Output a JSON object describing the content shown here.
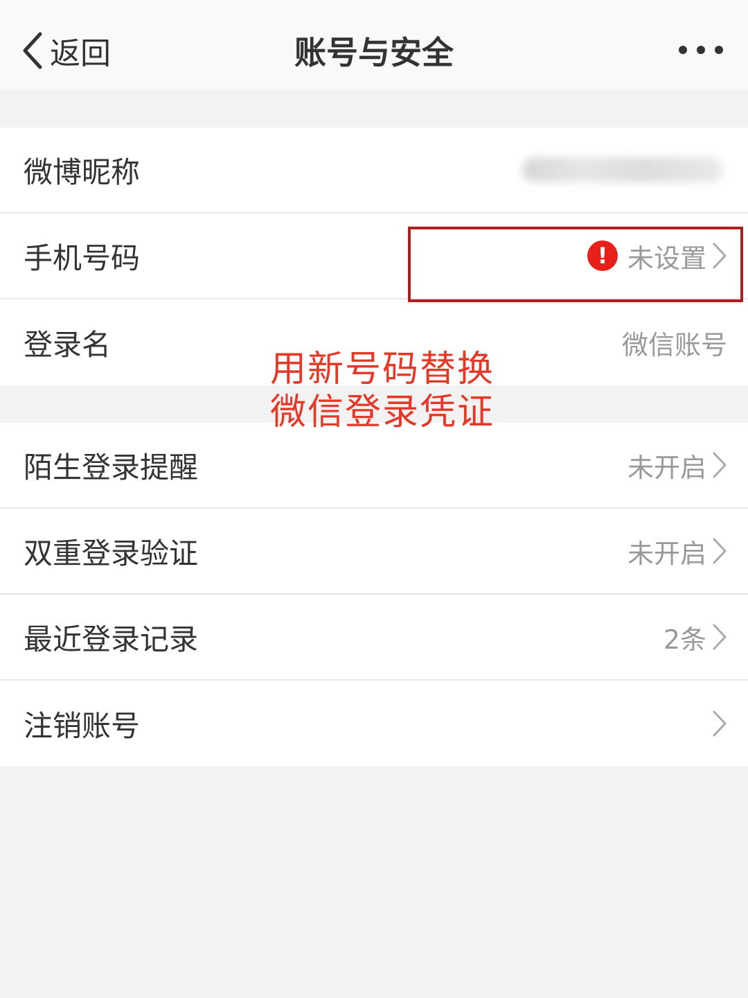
{
  "navbar": {
    "back_label": "返回",
    "title": "账号与安全"
  },
  "section1": {
    "items": [
      {
        "label": "微博昵称",
        "value": ""
      },
      {
        "label": "手机号码",
        "value": "未设置"
      },
      {
        "label": "登录名",
        "value": "微信账号"
      }
    ]
  },
  "section2": {
    "items": [
      {
        "label": "陌生登录提醒",
        "value": "未开启"
      },
      {
        "label": "双重登录验证",
        "value": "未开启"
      },
      {
        "label": "最近登录记录",
        "value": "2条"
      },
      {
        "label": "注销账号",
        "value": ""
      }
    ]
  },
  "annotation": {
    "line1": "用新号码替换",
    "line2": "微信登录凭证"
  },
  "icons": {
    "warning": "!"
  },
  "colors": {
    "accent_red": "#e8201a",
    "annotation_red": "#e23a28",
    "highlight_border": "#b11e1e"
  }
}
